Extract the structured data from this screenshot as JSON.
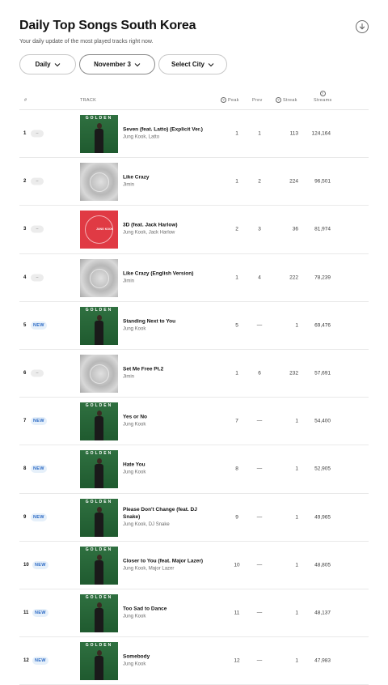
{
  "header": {
    "title": "Daily Top Songs South Korea",
    "subtitle": "Your daily update of the most played tracks right now."
  },
  "filters": {
    "frequency": "Daily",
    "date": "November 3",
    "city": "Select City"
  },
  "columns": {
    "rank": "#",
    "track": "TRACK",
    "peak": "Peak",
    "prev": "Prev",
    "streak": "Streak",
    "streams": "Streams"
  },
  "rows": [
    {
      "rank": "1",
      "badge": "–",
      "title": "Seven (feat. Latto) (Explicit Ver.)",
      "artist": "Jung Kook, Latto",
      "art": "golden",
      "art_text": "GOLDEN",
      "peak": "1",
      "prev": "1",
      "streak": "113",
      "streams": "124,164"
    },
    {
      "rank": "2",
      "badge": "–",
      "title": "Like Crazy",
      "artist": "Jimin",
      "art": "silver",
      "peak": "1",
      "prev": "2",
      "streak": "224",
      "streams": "96,501"
    },
    {
      "rank": "3",
      "badge": "–",
      "title": "3D (feat. Jack Harlow)",
      "artist": "Jung Kook, Jack Harlow",
      "art": "red",
      "art_text": "JUNG KOOK",
      "peak": "2",
      "prev": "3",
      "streak": "36",
      "streams": "81,974"
    },
    {
      "rank": "4",
      "badge": "–",
      "title": "Like Crazy (English Version)",
      "artist": "Jimin",
      "art": "silver",
      "peak": "1",
      "prev": "4",
      "streak": "222",
      "streams": "78,239"
    },
    {
      "rank": "5",
      "badge": "NEW",
      "title": "Standing Next to You",
      "artist": "Jung Kook",
      "art": "golden",
      "art_text": "GOLDEN",
      "peak": "5",
      "prev": "—",
      "streak": "1",
      "streams": "69,476"
    },
    {
      "rank": "6",
      "badge": "–",
      "title": "Set Me Free Pt.2",
      "artist": "Jimin",
      "art": "silver",
      "peak": "1",
      "prev": "6",
      "streak": "232",
      "streams": "57,691"
    },
    {
      "rank": "7",
      "badge": "NEW",
      "title": "Yes or No",
      "artist": "Jung Kook",
      "art": "golden",
      "art_text": "GOLDEN",
      "peak": "7",
      "prev": "—",
      "streak": "1",
      "streams": "54,400"
    },
    {
      "rank": "8",
      "badge": "NEW",
      "title": "Hate You",
      "artist": "Jung Kook",
      "art": "golden",
      "art_text": "GOLDEN",
      "peak": "8",
      "prev": "—",
      "streak": "1",
      "streams": "52,905"
    },
    {
      "rank": "9",
      "badge": "NEW",
      "title": "Please Don't Change (feat. DJ Snake)",
      "artist": "Jung Kook, DJ Snake",
      "art": "golden",
      "art_text": "GOLDEN",
      "peak": "9",
      "prev": "—",
      "streak": "1",
      "streams": "49,965"
    },
    {
      "rank": "10",
      "badge": "NEW",
      "title": "Closer to You (feat. Major Lazer)",
      "artist": "Jung Kook, Major Lazer",
      "art": "golden",
      "art_text": "GOLDEN",
      "peak": "10",
      "prev": "—",
      "streak": "1",
      "streams": "48,805"
    },
    {
      "rank": "11",
      "badge": "NEW",
      "title": "Too Sad to Dance",
      "artist": "Jung Kook",
      "art": "golden",
      "art_text": "GOLDEN",
      "peak": "11",
      "prev": "—",
      "streak": "1",
      "streams": "48,137"
    },
    {
      "rank": "12",
      "badge": "NEW",
      "title": "Somebody",
      "artist": "Jung Kook",
      "art": "golden",
      "art_text": "GOLDEN",
      "peak": "12",
      "prev": "—",
      "streak": "1",
      "streams": "47,983"
    }
  ],
  "colors": {
    "new_badge_bg": "#e6f0fa",
    "new_badge_text": "#2d6bc5",
    "golden_art": "#2f7040",
    "red_art": "#e03a44"
  },
  "icons": [
    "download-icon",
    "chevron-down-icon",
    "help-icon"
  ]
}
